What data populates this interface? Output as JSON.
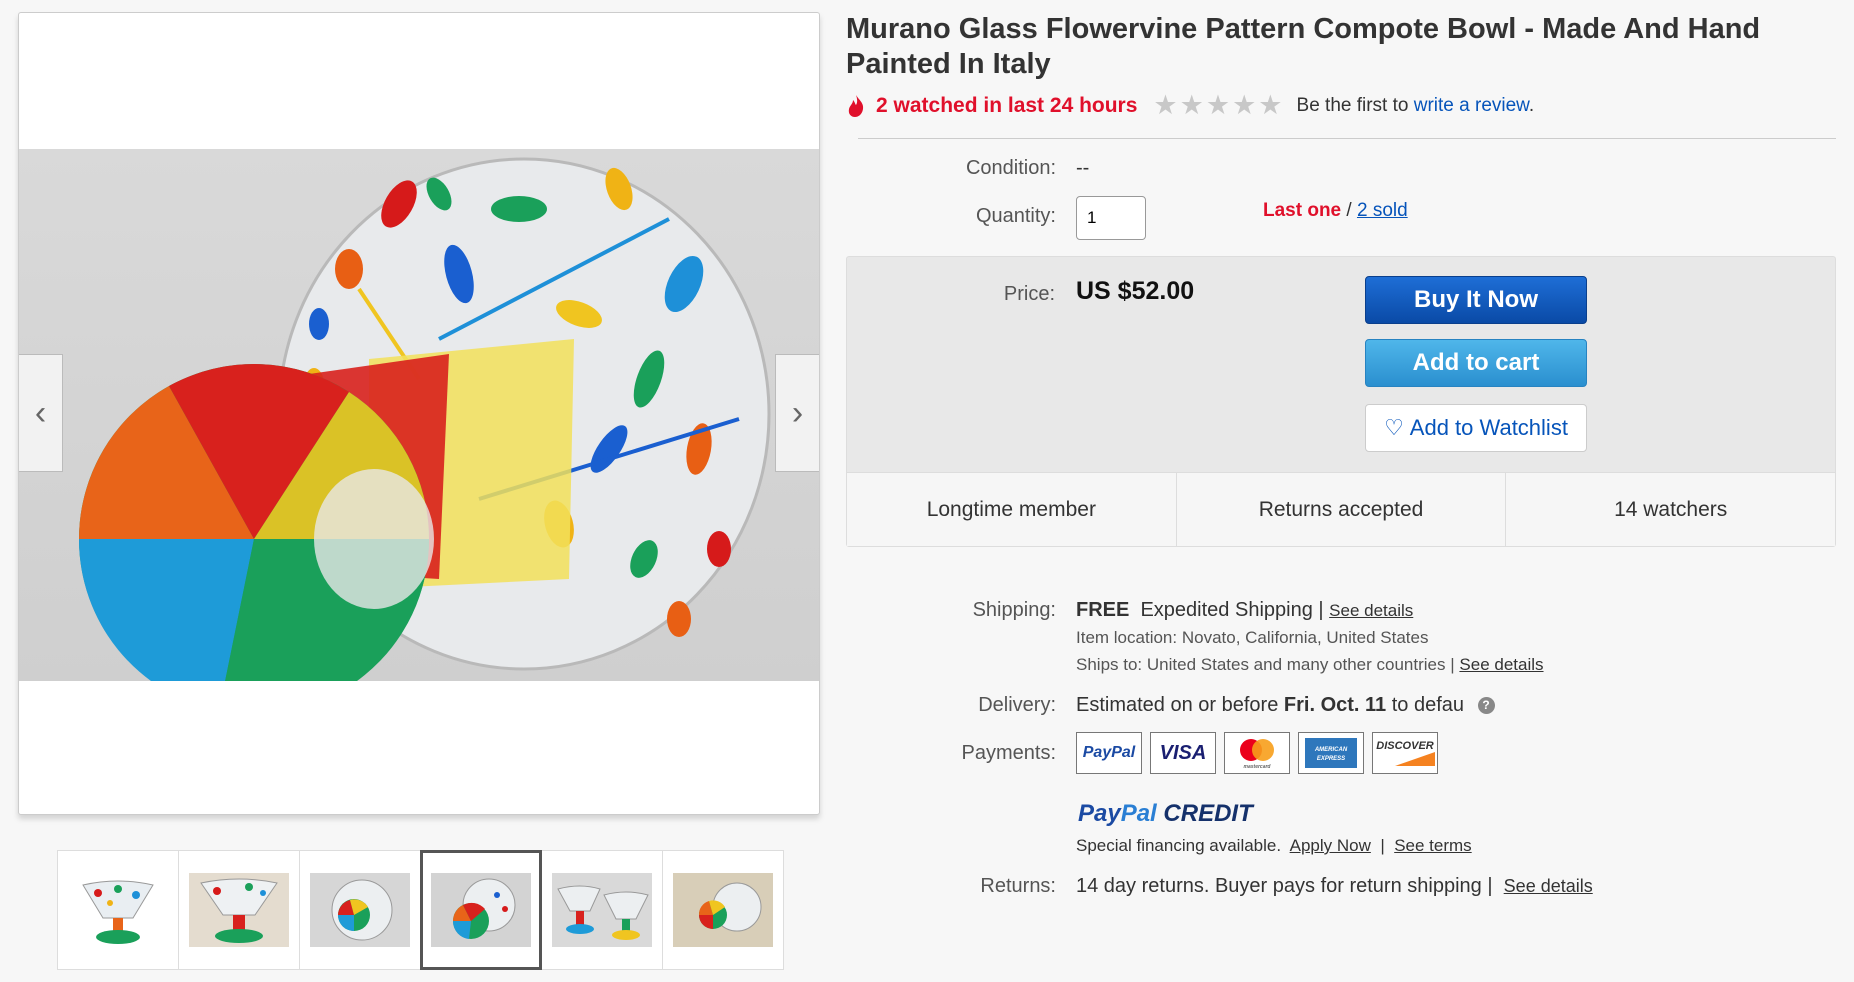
{
  "title": "Murano Glass Flowervine Pattern Compote Bowl - Made And Hand Painted In Italy",
  "watch": {
    "watched_text": "2 watched in last 24 hours",
    "review_prefix": "Be the first to",
    "review_link": "write a review",
    "review_suffix": "."
  },
  "gallery": {
    "prev_icon": "‹",
    "next_icon": "›",
    "selected_index": 3
  },
  "condition": {
    "label": "Condition:",
    "value": "--"
  },
  "quantity": {
    "label": "Quantity:",
    "value": "1",
    "last_one": "Last one",
    "separator": "/",
    "sold": "2 sold"
  },
  "price": {
    "label": "Price:",
    "value": "US $52.00",
    "buy_now": "Buy It Now",
    "add_to_cart": "Add to cart",
    "add_to_watchlist": "Add to Watchlist"
  },
  "stats": [
    "Longtime member",
    "Returns accepted",
    "14 watchers"
  ],
  "shipping": {
    "label": "Shipping:",
    "free": "FREE",
    "method": "Expedited Shipping",
    "sep": "|",
    "details": "See details",
    "location_label": "Item location:",
    "location": "Novato, California, United States",
    "ships_label": "Ships to:",
    "ships_to": "United States and many other countries",
    "ships_details": "See details"
  },
  "delivery": {
    "label": "Delivery:",
    "prefix": "Estimated on or before",
    "date": "Fri. Oct. 11",
    "suffix": "to defau",
    "help": "?"
  },
  "payments": {
    "label": "Payments:",
    "methods": [
      "PayPal",
      "VISA",
      "mastercard",
      "AMERICAN EXPRESS",
      "DISCOVER"
    ],
    "credit_pay": "Pay",
    "credit_pal": "Pal",
    "credit_word": "CREDIT",
    "financing": "Special financing available.",
    "apply": "Apply Now",
    "sep": "|",
    "terms": "See terms"
  },
  "returns": {
    "label": "Returns:",
    "text": "14 day returns. Buyer pays for return shipping",
    "sep": "|",
    "details": "See details"
  },
  "colors": {
    "accent_red": "#e0102b",
    "link_blue": "#0654ba",
    "buy_blue": "#0a4aa6",
    "cart_blue": "#2a8fcf"
  }
}
